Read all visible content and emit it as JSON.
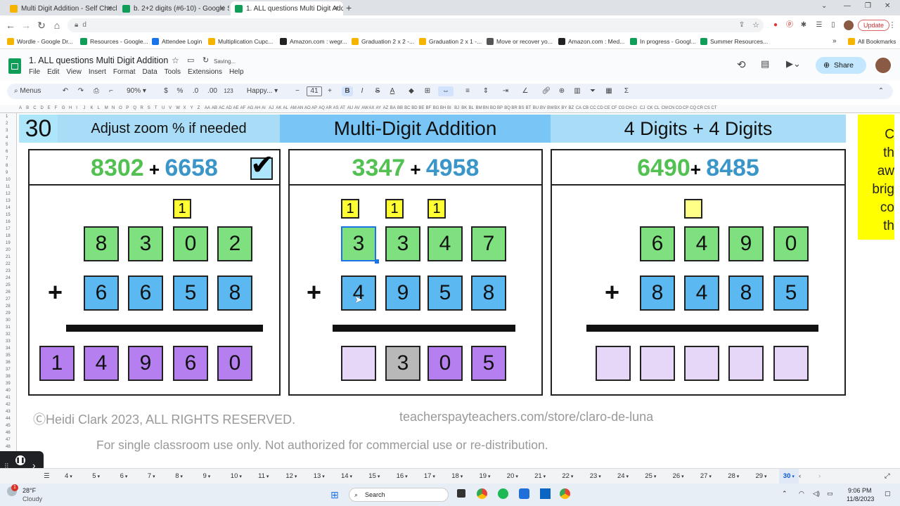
{
  "browser": {
    "tabs": [
      {
        "title": "Multi Digit Addition - Self Checki",
        "color": "#f4b400"
      },
      {
        "title": "b. 2+2 digits (#6-10) - Google Sl",
        "color": "#0f9d58"
      },
      {
        "title": "1. ALL questions Multi Digit Addi",
        "color": "#0f9d58"
      }
    ],
    "new_tab": "+",
    "url": "d",
    "update_label": "Update",
    "bookmarks": [
      "Wordle - Google Dr...",
      "Resources - Google...",
      "Attendee Login",
      "Multiplication Cupc...",
      "Amazon.com : wegr...",
      "Graduation 2 x 2 -...",
      "Graduation 2 x 1 -...",
      "Move or recover yo...",
      "Amazon.com : Med...",
      "In progress - Googl...",
      "Summer Resources..."
    ],
    "all_bookmarks": "All Bookmarks"
  },
  "sheets": {
    "doc_title": "1. ALL questions Multi Digit Addition",
    "saving": "Saving...",
    "menus": [
      "File",
      "Edit",
      "View",
      "Insert",
      "Format",
      "Data",
      "Tools",
      "Extensions",
      "Help"
    ],
    "share_label": "Share",
    "toolbar": {
      "menus_label": "Menus",
      "zoom": "90%",
      "currency": "$",
      "percent": "%",
      "dec_minus": ".0",
      "dec_plus": ".00",
      "num_format": "123",
      "font": "Happy...",
      "font_size": "41",
      "bold": "B",
      "italic": "I",
      "strike": "S",
      "text_color": "A"
    },
    "columns": [
      "A",
      "B",
      "C",
      "D",
      "E",
      "F",
      "G",
      "H",
      "I",
      "J",
      "K",
      "L",
      "M",
      "N",
      "O",
      "P",
      "Q",
      "R",
      "S",
      "T",
      "U",
      "V",
      "W",
      "X",
      "Y",
      "Z",
      "AA",
      "AB",
      "AC",
      "AD",
      "AE",
      "AF",
      "AG",
      "AH",
      "AI",
      "AJ",
      "AK",
      "AL",
      "AM",
      "AN",
      "AO",
      "AP",
      "AQ",
      "AR",
      "AS",
      "AT",
      "AU",
      "AV",
      "AW",
      "AX",
      "AY",
      "AZ",
      "BA",
      "BB",
      "BC",
      "BD",
      "BE",
      "BF",
      "BG",
      "BH",
      "BI",
      "BJ",
      "BK",
      "BL",
      "BM",
      "BN",
      "BO",
      "BP",
      "BQ",
      "BR",
      "BS",
      "BT",
      "BU",
      "BV",
      "BW",
      "BX",
      "BY",
      "BZ",
      "CA",
      "CB",
      "CC",
      "CD",
      "CE",
      "CF",
      "CG",
      "CH",
      "CI",
      "CJ",
      "CK",
      "CL",
      "CM",
      "CN",
      "CO",
      "CP",
      "CQ",
      "CR",
      "CS",
      "CT"
    ],
    "rows": [
      "1",
      "2",
      "3",
      "4",
      "5",
      "6",
      "7",
      "8",
      "9",
      "10",
      "11",
      "12",
      "13",
      "14",
      "15",
      "16",
      "17",
      "18",
      "19",
      "20",
      "21",
      "22",
      "23",
      "24",
      "25",
      "26",
      "27",
      "28",
      "29",
      "30",
      "31",
      "32",
      "33",
      "34",
      "35",
      "36",
      "37",
      "38",
      "39",
      "40",
      "41",
      "42",
      "43",
      "44",
      "45",
      "46",
      "47",
      "48",
      "49"
    ],
    "sheet_tabs": [
      "4",
      "5",
      "6",
      "7",
      "8",
      "9",
      "10",
      "11",
      "12",
      "13",
      "14",
      "15",
      "16",
      "17",
      "18",
      "19",
      "20",
      "21",
      "22",
      "23",
      "24",
      "25",
      "26",
      "27",
      "28",
      "29",
      "30"
    ],
    "active_sheet": "30"
  },
  "content": {
    "number": "30",
    "zoom_hint": "Adjust zoom % if needed",
    "title": "Multi-Digit Addition",
    "subtitle": "4 Digits + 4 Digits",
    "side_text": [
      "C",
      "th",
      "aw",
      "brig",
      "co",
      "th"
    ],
    "problems": [
      {
        "a": "8302",
        "b": "6658",
        "checked": true,
        "carries": [
          "",
          "",
          "1",
          "",
          ""
        ],
        "top": [
          "8",
          "3",
          "0",
          "2"
        ],
        "bottom": [
          "6",
          "6",
          "5",
          "8"
        ],
        "answer": [
          "1",
          "4",
          "9",
          "6",
          "0"
        ]
      },
      {
        "a": "3347",
        "b": "4958",
        "checked": false,
        "carries": [
          "1",
          "1",
          "1"
        ],
        "top": [
          "3",
          "3",
          "4",
          "7"
        ],
        "bottom": [
          "4",
          "9",
          "5",
          "8"
        ],
        "answer": [
          "",
          "3",
          "0",
          "5"
        ]
      },
      {
        "a": "6490",
        "b": "8485",
        "checked": false,
        "carries": [
          ""
        ],
        "top": [
          "6",
          "4",
          "9",
          "0"
        ],
        "bottom": [
          "8",
          "4",
          "8",
          "5"
        ],
        "answer": [
          "",
          "",
          "",
          "",
          ""
        ]
      }
    ],
    "plus": "+",
    "copyright": "ⒸHeidi Clark 2023,  ALL RIGHTS RESERVED.",
    "store": "teacherspayteachers.com/store/claro-de-luna",
    "license": "For single classroom use only. Not authorized for commercial use or re-distribution."
  },
  "taskbar": {
    "weather_temp": "28°F",
    "weather_desc": "Cloudy",
    "search": "Search",
    "time": "9:06 PM",
    "date": "11/8/2023",
    "notif_count": "1"
  }
}
